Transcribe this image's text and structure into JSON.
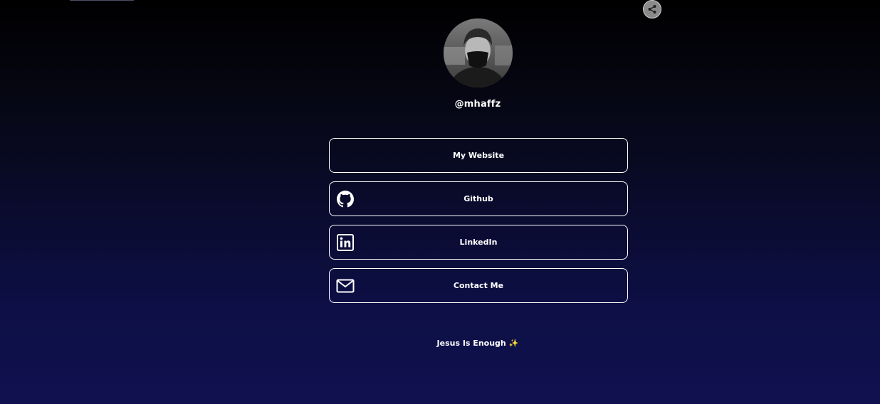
{
  "profile": {
    "username": "@mhaffz"
  },
  "links": [
    {
      "label": "My Website",
      "icon": "none"
    },
    {
      "label": "Github",
      "icon": "github-icon"
    },
    {
      "label": "LinkedIn",
      "icon": "linkedin-icon"
    },
    {
      "label": "Contact Me",
      "icon": "mail-icon"
    }
  ],
  "footer": {
    "text": "Jesus Is Enough",
    "emoji": "✨"
  },
  "share": {
    "icon": "share-icon"
  },
  "colors": {
    "background_top": "#000000",
    "background_bottom": "#10114f",
    "button_border": "#ffffff",
    "text": "#ffffff"
  }
}
